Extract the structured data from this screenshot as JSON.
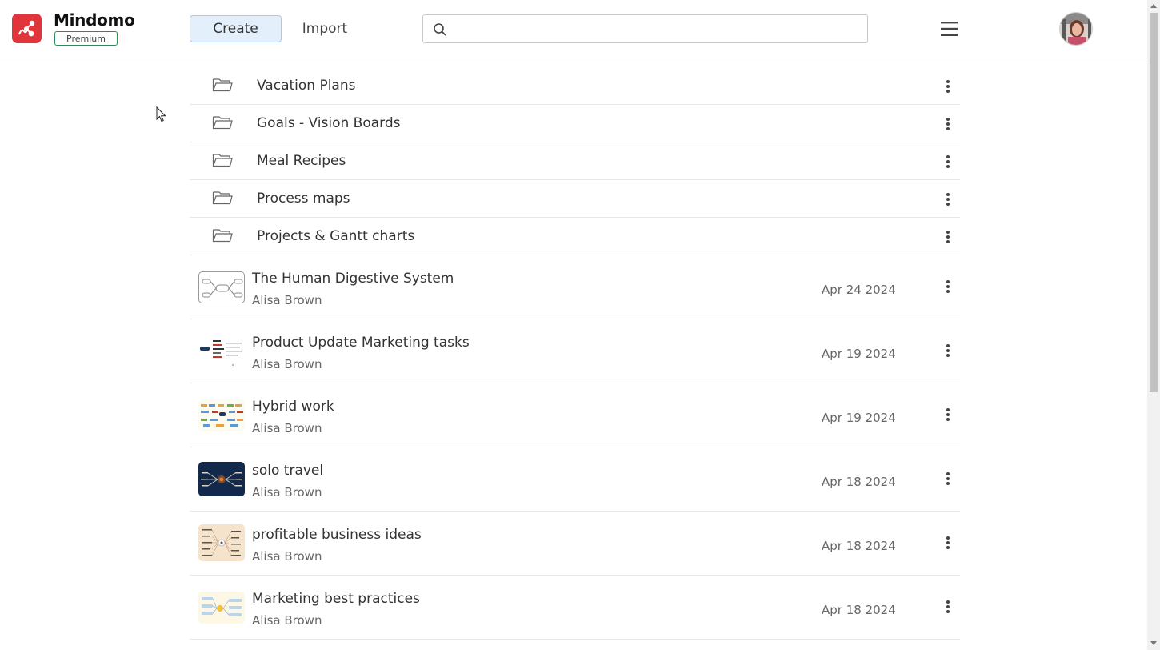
{
  "app": {
    "brand": "Mindomo",
    "plan_badge": "Premium",
    "brand_color": "#e0353b"
  },
  "toolbar": {
    "create_label": "Create",
    "import_label": "Import",
    "search_placeholder": "",
    "menu_icon": "hamburger-icon"
  },
  "folders": [
    {
      "name": "Vacation Plans"
    },
    {
      "name": "Goals - Vision Boards"
    },
    {
      "name": "Meal Recipes"
    },
    {
      "name": "Process maps"
    },
    {
      "name": "Projects & Gantt charts"
    }
  ],
  "maps": [
    {
      "title": "The Human Digestive System",
      "author": "Alisa Brown",
      "date": "Apr 24 2024",
      "thumb": "diagram-outline"
    },
    {
      "title": "Product Update Marketing tasks",
      "author": "Alisa Brown",
      "date": "Apr 19 2024",
      "thumb": "white-map"
    },
    {
      "title": "Hybrid work",
      "author": "Alisa Brown",
      "date": "Apr 19 2024",
      "thumb": "colorful-map"
    },
    {
      "title": "solo travel",
      "author": "Alisa Brown",
      "date": "Apr 18 2024",
      "thumb": "dark-map"
    },
    {
      "title": "profitable business ideas",
      "author": "Alisa Brown",
      "date": "Apr 18 2024",
      "thumb": "beige-map"
    },
    {
      "title": "Marketing best practices",
      "author": "Alisa Brown",
      "date": "Apr 18 2024",
      "thumb": "light-map"
    }
  ]
}
